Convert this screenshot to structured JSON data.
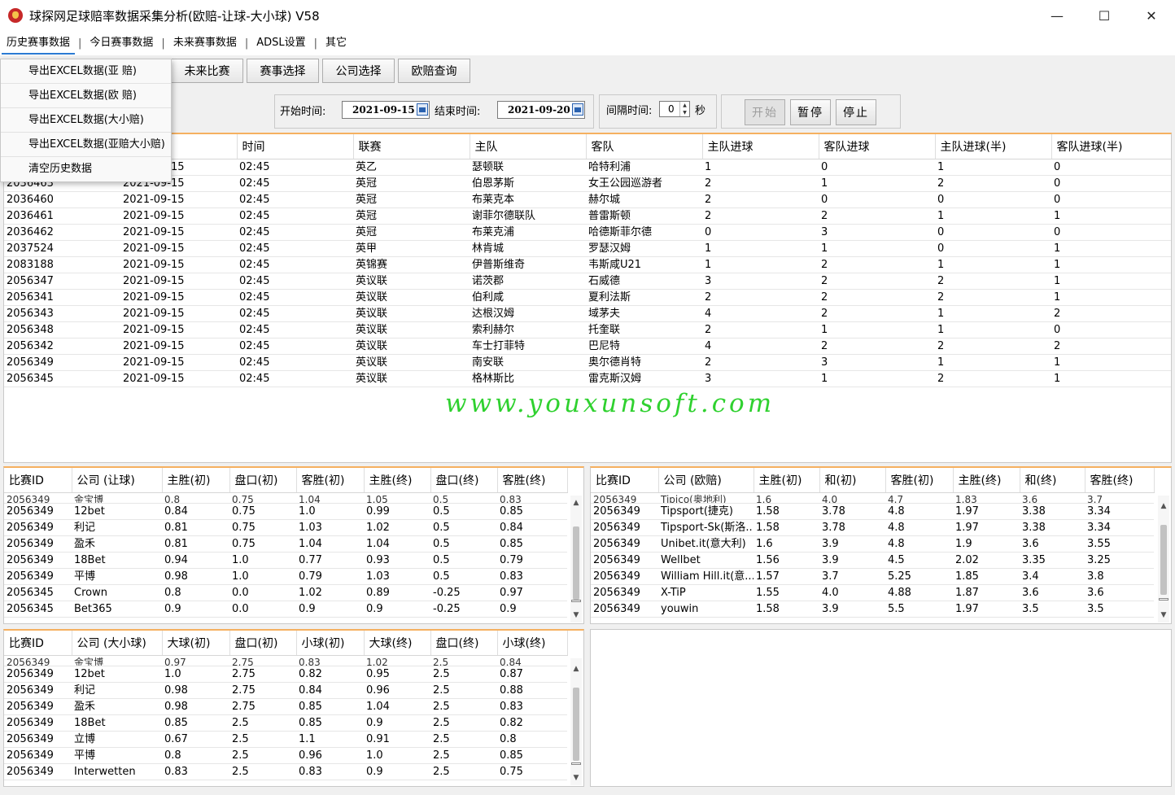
{
  "window": {
    "title": "球探网足球赔率数据采集分析(欧赔-让球-大小球) V58",
    "minimize": "—",
    "maximize": "☐",
    "close": "✕"
  },
  "menu": [
    "历史赛事数据",
    "今日赛事数据",
    "未来赛事数据",
    "ADSL设置",
    "其它"
  ],
  "menu_sep": "|",
  "dropdown": [
    "导出EXCEL数据(亚 赔)",
    "导出EXCEL数据(欧 赔)",
    "导出EXCEL数据(大小赔)",
    "导出EXCEL数据(亚赔大小赔)",
    "清空历史数据"
  ],
  "tabs": [
    "未来比赛",
    "赛事选择",
    "公司选择",
    "欧赔查询"
  ],
  "controls": {
    "start_label": "开始时间:",
    "start_date": "2021-09-15",
    "end_label": "结束时间:",
    "end_date": "2021-09-20",
    "interval_label": "间隔时间:",
    "interval_value": "0",
    "interval_unit": "秒",
    "start_btn": "开始",
    "pause_btn": "暂停",
    "stop_btn": "停止"
  },
  "matches": {
    "columns": [
      "时间",
      "联赛",
      "主队",
      "客队",
      "主队进球",
      "客队进球",
      "主队进球(半)",
      "客队进球(半)"
    ],
    "rows": [
      [
        "",
        "2021-09-15",
        "02:45",
        "英乙",
        "瑟顿联",
        "哈特利浦",
        "1",
        "0",
        "1",
        "0"
      ],
      [
        "2036463",
        "2021-09-15",
        "02:45",
        "英冠",
        "伯恩茅斯",
        "女王公园巡游者",
        "2",
        "1",
        "2",
        "0"
      ],
      [
        "2036460",
        "2021-09-15",
        "02:45",
        "英冠",
        "布莱克本",
        "赫尔城",
        "2",
        "0",
        "0",
        "0"
      ],
      [
        "2036461",
        "2021-09-15",
        "02:45",
        "英冠",
        "谢菲尔德联队",
        "普雷斯顿",
        "2",
        "2",
        "1",
        "1"
      ],
      [
        "2036462",
        "2021-09-15",
        "02:45",
        "英冠",
        "布莱克浦",
        "哈德斯菲尔德",
        "0",
        "3",
        "0",
        "0"
      ],
      [
        "2037524",
        "2021-09-15",
        "02:45",
        "英甲",
        "林肯城",
        "罗瑟汉姆",
        "1",
        "1",
        "0",
        "1"
      ],
      [
        "2083188",
        "2021-09-15",
        "02:45",
        "英锦赛",
        "伊普斯维奇",
        "韦斯咸U21",
        "1",
        "2",
        "1",
        "1"
      ],
      [
        "2056347",
        "2021-09-15",
        "02:45",
        "英议联",
        "诺茨郡",
        "石威德",
        "3",
        "2",
        "2",
        "1"
      ],
      [
        "2056341",
        "2021-09-15",
        "02:45",
        "英议联",
        "伯利咸",
        "夏利法斯",
        "2",
        "2",
        "2",
        "1"
      ],
      [
        "2056343",
        "2021-09-15",
        "02:45",
        "英议联",
        "达根汉姆",
        "域茅夫",
        "4",
        "2",
        "1",
        "2"
      ],
      [
        "2056348",
        "2021-09-15",
        "02:45",
        "英议联",
        "索利赫尔",
        "托奎联",
        "2",
        "1",
        "1",
        "0"
      ],
      [
        "2056342",
        "2021-09-15",
        "02:45",
        "英议联",
        "车士打菲特",
        "巴尼特",
        "4",
        "2",
        "2",
        "2"
      ],
      [
        "2056349",
        "2021-09-15",
        "02:45",
        "英议联",
        "南安联",
        "奥尔德肖特",
        "2",
        "3",
        "1",
        "1"
      ],
      [
        "2056345",
        "2021-09-15",
        "02:45",
        "英议联",
        "格林斯比",
        "雷克斯汉姆",
        "3",
        "1",
        "2",
        "1"
      ]
    ]
  },
  "handicap": {
    "columns": [
      "比赛ID",
      "公司 (让球)",
      "主胜(初)",
      "盘口(初)",
      "客胜(初)",
      "主胜(终)",
      "盘口(终)",
      "客胜(终)"
    ],
    "partial": [
      "2056349",
      "金宝博",
      "0.8",
      "0.75",
      "1.04",
      "1.05",
      "0.5",
      "0.83"
    ],
    "rows": [
      [
        "2056349",
        "12bet",
        "0.84",
        "0.75",
        "1.0",
        "0.99",
        "0.5",
        "0.85"
      ],
      [
        "2056349",
        "利记",
        "0.81",
        "0.75",
        "1.03",
        "1.02",
        "0.5",
        "0.84"
      ],
      [
        "2056349",
        "盈禾",
        "0.81",
        "0.75",
        "1.04",
        "1.04",
        "0.5",
        "0.85"
      ],
      [
        "2056349",
        "18Bet",
        "0.94",
        "1.0",
        "0.77",
        "0.93",
        "0.5",
        "0.79"
      ],
      [
        "2056349",
        "平博",
        "0.98",
        "1.0",
        "0.79",
        "1.03",
        "0.5",
        "0.83"
      ],
      [
        "2056345",
        "Crown",
        "0.8",
        "0.0",
        "1.02",
        "0.89",
        "-0.25",
        "0.97"
      ],
      [
        "2056345",
        "Bet365",
        "0.9",
        "0.0",
        "0.9",
        "0.9",
        "-0.25",
        "0.9"
      ]
    ]
  },
  "europe": {
    "columns": [
      "比赛ID",
      "公司 (欧赔)",
      "主胜(初)",
      "和(初)",
      "客胜(初)",
      "主胜(终)",
      "和(终)",
      "客胜(终)"
    ],
    "partial": [
      "2056349",
      "Tipico(奥地利)",
      "1.6",
      "4.0",
      "4.7",
      "1.83",
      "3.6",
      "3.7"
    ],
    "rows": [
      [
        "2056349",
        "Tipsport(捷克)",
        "1.58",
        "3.78",
        "4.8",
        "1.97",
        "3.38",
        "3.34"
      ],
      [
        "2056349",
        "Tipsport-Sk(斯洛...",
        "1.58",
        "3.78",
        "4.8",
        "1.97",
        "3.38",
        "3.34"
      ],
      [
        "2056349",
        "Unibet.it(意大利)",
        "1.6",
        "3.9",
        "4.8",
        "1.9",
        "3.6",
        "3.55"
      ],
      [
        "2056349",
        "Wellbet",
        "1.56",
        "3.9",
        "4.5",
        "2.02",
        "3.35",
        "3.25"
      ],
      [
        "2056349",
        "William Hill.it(意...",
        "1.57",
        "3.7",
        "5.25",
        "1.85",
        "3.4",
        "3.8"
      ],
      [
        "2056349",
        "X-TiP",
        "1.55",
        "4.0",
        "4.88",
        "1.87",
        "3.6",
        "3.6"
      ],
      [
        "2056349",
        "youwin",
        "1.58",
        "3.9",
        "5.5",
        "1.97",
        "3.5",
        "3.5"
      ]
    ]
  },
  "overunder": {
    "columns": [
      "比赛ID",
      "公司 (大小球)",
      "大球(初)",
      "盘口(初)",
      "小球(初)",
      "大球(终)",
      "盘口(终)",
      "小球(终)"
    ],
    "partial": [
      "2056349",
      "金宝博",
      "0.97",
      "2.75",
      "0.83",
      "1.02",
      "2.5",
      "0.84"
    ],
    "rows": [
      [
        "2056349",
        "12bet",
        "1.0",
        "2.75",
        "0.82",
        "0.95",
        "2.5",
        "0.87"
      ],
      [
        "2056349",
        "利记",
        "0.98",
        "2.75",
        "0.84",
        "0.96",
        "2.5",
        "0.88"
      ],
      [
        "2056349",
        "盈禾",
        "0.98",
        "2.75",
        "0.85",
        "1.04",
        "2.5",
        "0.83"
      ],
      [
        "2056349",
        "18Bet",
        "0.85",
        "2.5",
        "0.85",
        "0.9",
        "2.5",
        "0.82"
      ],
      [
        "2056349",
        "立博",
        "0.67",
        "2.5",
        "1.1",
        "0.91",
        "2.5",
        "0.8"
      ],
      [
        "2056349",
        "平博",
        "0.8",
        "2.5",
        "0.96",
        "1.0",
        "2.5",
        "0.85"
      ],
      [
        "2056349",
        "Interwetten",
        "0.83",
        "2.5",
        "0.83",
        "0.9",
        "2.5",
        "0.75"
      ]
    ]
  },
  "watermark": "www.youxunsoft.com",
  "scroll_up": "▲",
  "scroll_down": "▼"
}
